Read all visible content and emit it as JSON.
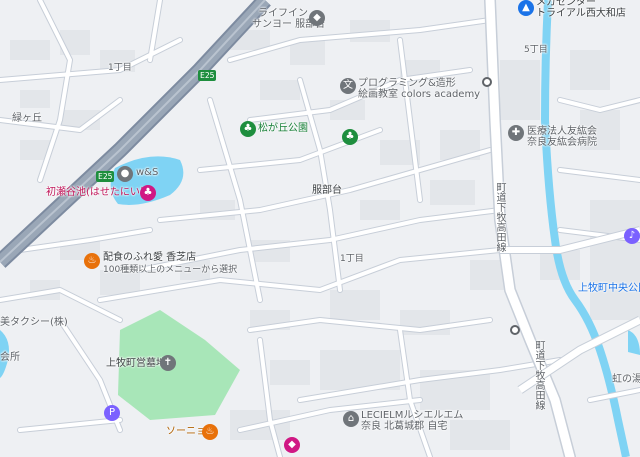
{
  "map": {
    "colors": {
      "background": "#eef0f3",
      "road": "#ffffff",
      "road_casing": "#c7ced8",
      "highway": "#9aa7b7",
      "park": "#a8e6b8",
      "water": "#7fd3f4",
      "building": "#e3e6ea"
    },
    "highway_shields": [
      "E25",
      "E25"
    ],
    "labels": {
      "lifein": "ライフイン",
      "lifein_sub": "サンヨー 服部台",
      "megacenter": "メガセンター",
      "megacenter_sub": "トライアル西大和店",
      "chome5": "5丁目",
      "chome1_top": "1丁目",
      "midorigaoka": "緑ヶ丘",
      "programming": "プログラミング&造形",
      "programming_sub": "絵画教室 colors academy",
      "matsugaoka_park": "松が丘公園",
      "hospital": "医療法人友紘会",
      "hospital_sub": "奈良友紘会病院",
      "hattoridai": "服部台",
      "ws": "w&S",
      "hatsuse_pond": "初瀬谷池(はせたにいけ)",
      "road_right_vertical": "町道下牧高田線",
      "chome1_mid": "1丁目",
      "haishoku": "配食のふれ愛 香芝店",
      "haishoku_sub": "100種類以上のメニューから選択",
      "taxi": "美タクシー(株)",
      "kaisho": "会所",
      "kamimaki_cemetery": "上牧町営墓地",
      "sonia": "ソーニョ",
      "leciel": "LECIELMルシエルエム",
      "leciel_sub": "奈良 北葛城郡 自宅",
      "kamimaki_hall": "上牧町中央公民館",
      "nijinoyu": "虹の湯",
      "road_lower_vertical": "町道下牧高田線"
    },
    "icons": [
      "highway-shield-icon",
      "shopping-pin-icon",
      "education-pin-icon",
      "park-pin-icon",
      "tree-icon",
      "hospital-pin-icon",
      "bus-stop-icon",
      "music-pin-icon",
      "food-pin-icon",
      "cemetery-pin-icon",
      "parking-icon",
      "restaurant-pin-icon",
      "home-pin-icon"
    ]
  }
}
